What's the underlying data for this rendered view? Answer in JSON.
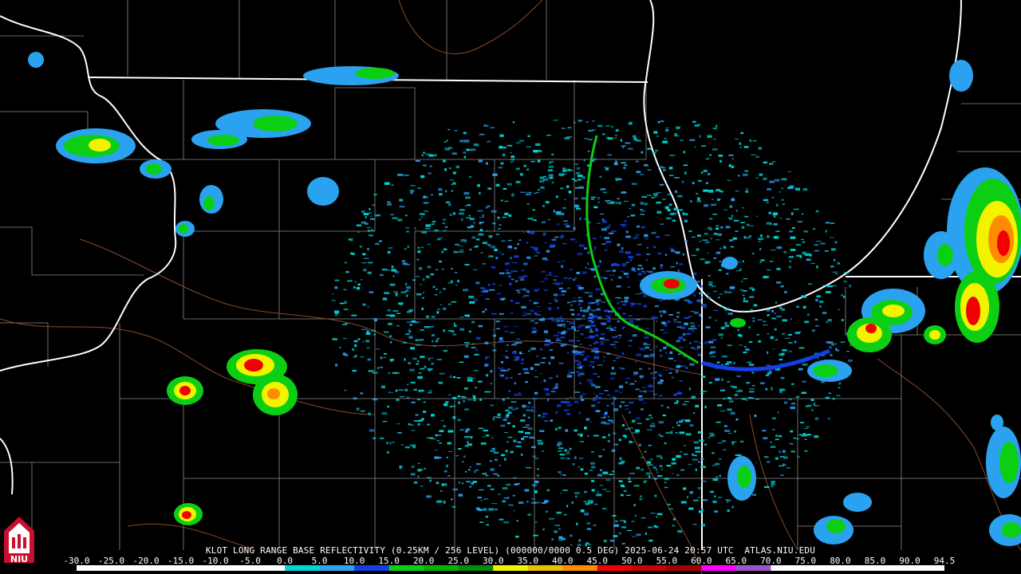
{
  "header": {
    "caption": "KLOT LONG RANGE BASE REFLECTIVITY (0.25KM / 256 LEVEL) (000000/0000 0.5 DEG) 2025-06-24 20:57 UTC  ATLAS.NIU.EDU"
  },
  "legend": {
    "labels": [
      "-30.0",
      "-25.0",
      "-20.0",
      "-15.0",
      "-10.0",
      "-5.0",
      "0.0",
      "5.0",
      "10.0",
      "15.0",
      "20.0",
      "25.0",
      "30.0",
      "35.0",
      "40.0",
      "45.0",
      "50.0",
      "55.0",
      "60.0",
      "65.0",
      "70.0",
      "75.0",
      "80.0",
      "85.0",
      "90.0",
      "94.5"
    ],
    "colors": [
      "#ffffff",
      "#ffffff",
      "#ffffff",
      "#ffffff",
      "#ffffff",
      "#ffffff",
      "#00d8d8",
      "#2aa2f0",
      "#1240e6",
      "#0ccf13",
      "#08b20a",
      "#078a09",
      "#f3f300",
      "#e8c000",
      "#ff8c00",
      "#f00000",
      "#c80000",
      "#a00000",
      "#ff00ff",
      "#9a55c8",
      "#ffffff",
      "#ffffff",
      "#ffffff",
      "#ffffff",
      "#ffffff"
    ]
  },
  "logo": {
    "text": "NIU",
    "color": "#c8102e"
  },
  "map": {
    "background": "#000000",
    "radar_site": "KLOT",
    "colors": {
      "state_lines": "#ffffff",
      "county_lines": "#8a8a8a",
      "rivers": "#8b4a2a",
      "light": "#00d8d8",
      "light_blue": "#2aa2f0",
      "blue": "#1240e6",
      "green": "#0ccf13",
      "dark_green": "#078a09",
      "yellow": "#f3f300",
      "orange": "#ff8c00",
      "red": "#f00000",
      "dark_red": "#b00000"
    }
  }
}
